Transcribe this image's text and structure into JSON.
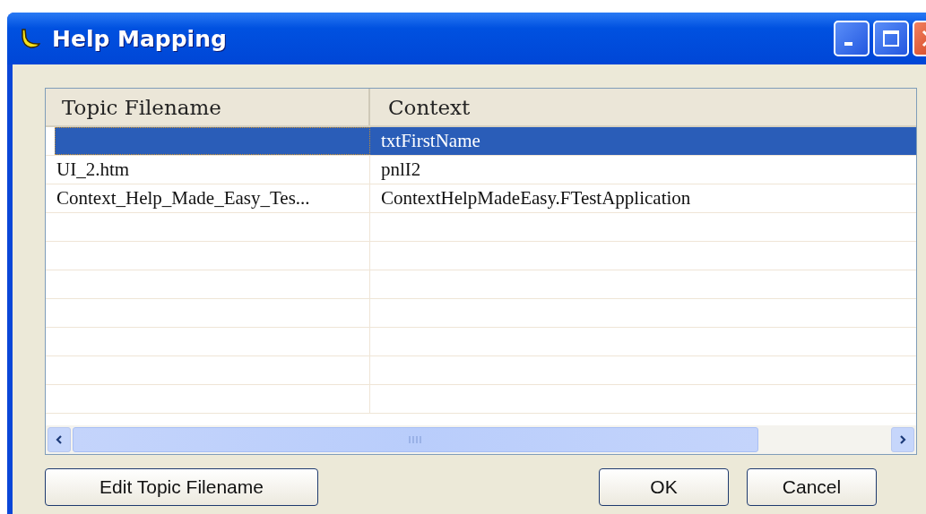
{
  "window": {
    "title": "Help Mapping"
  },
  "table": {
    "columns": [
      "Topic Filename",
      "Context"
    ],
    "rows": [
      {
        "cells": [
          "",
          "txtFirstName"
        ],
        "selected": true
      },
      {
        "cells": [
          "UI_2.htm",
          "pnlI2"
        ],
        "selected": false
      },
      {
        "cells": [
          "Context_Help_Made_Easy_Tes...",
          "ContextHelpMadeEasy.FTestApplication"
        ],
        "selected": false
      }
    ]
  },
  "buttons": [
    {
      "label": "Edit Topic Filename",
      "kind": "left"
    },
    {
      "label": "OK",
      "kind": "right"
    },
    {
      "label": "Cancel",
      "kind": "right"
    }
  ]
}
